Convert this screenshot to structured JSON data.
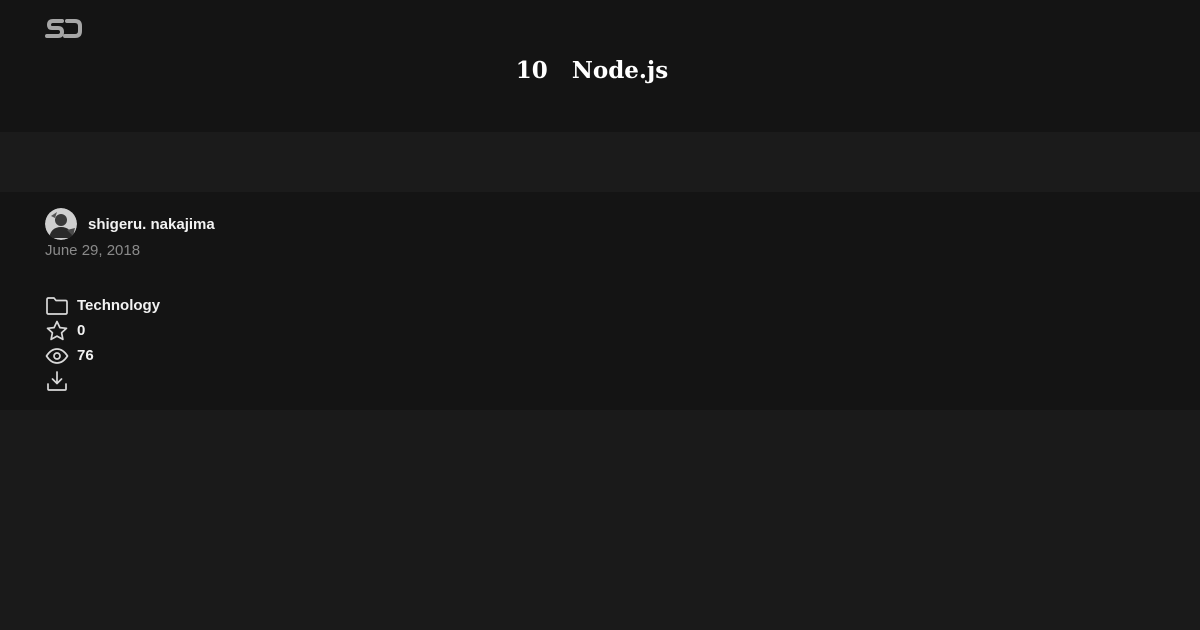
{
  "header": {
    "logo_icon": "sj-logo-icon",
    "title": "10   Node.js"
  },
  "author": {
    "name": "shigeru. nakajima",
    "avatar_icon": "user-avatar"
  },
  "post": {
    "date": "June 29, 2018",
    "category": "Technology",
    "stars": "0",
    "views": "76"
  },
  "icons": {
    "category": "folder-icon",
    "stars": "star-icon",
    "views": "eye-icon",
    "download": "download-icon"
  },
  "colors": {
    "header_bg": "#141414",
    "band_bg": "#1b1b1b",
    "page_bg": "#1a1a1a",
    "muted_text": "#8a8a8a",
    "icon_stroke": "#d9d9d9"
  }
}
